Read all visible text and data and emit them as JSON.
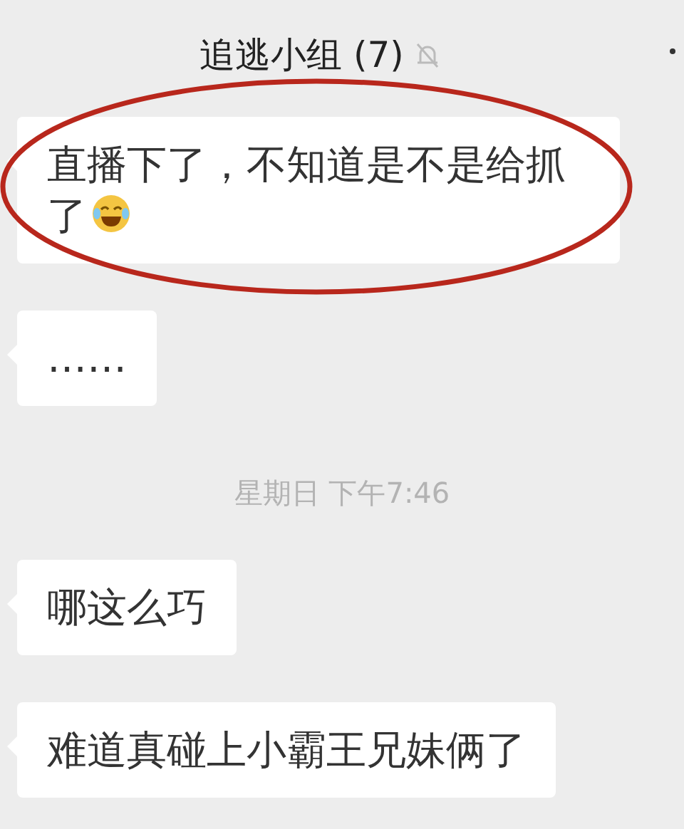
{
  "header": {
    "title": "追逃小组 (7)",
    "muted": true
  },
  "messages": [
    {
      "kind": "bubble",
      "text": "直播下了，不知道是不是给抓了",
      "emoji": true,
      "highlighted": true
    },
    {
      "kind": "bubble",
      "text": "……"
    },
    {
      "kind": "time",
      "text": "星期日 下午7:46"
    },
    {
      "kind": "bubble",
      "text": "哪这么巧"
    },
    {
      "kind": "bubble",
      "text": "难道真碰上小霸王兄妹俩了"
    }
  ]
}
